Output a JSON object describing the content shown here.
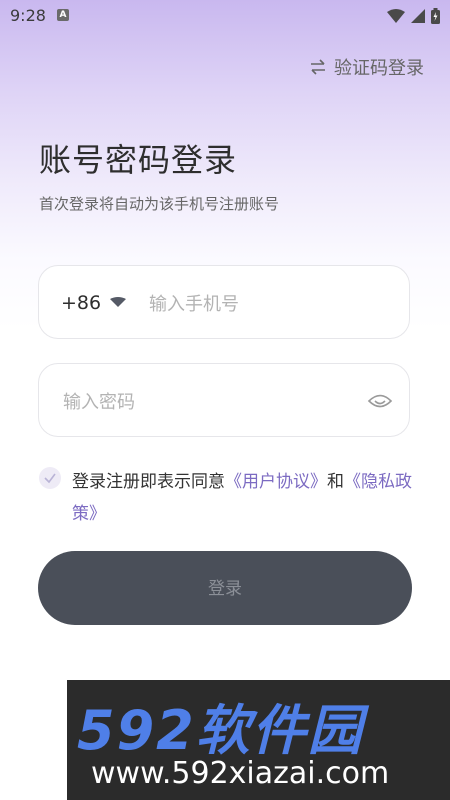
{
  "status_bar": {
    "time": "9:28",
    "badge": "A"
  },
  "header": {
    "switch_label": "验证码登录",
    "switch_icon": "swap-icon"
  },
  "title": "账号密码登录",
  "subtitle": "首次登录将自动为该手机号注册账号",
  "phone": {
    "country_code": "+86",
    "placeholder": "输入手机号"
  },
  "password": {
    "placeholder": "输入密码"
  },
  "agreement": {
    "prefix": "登录注册即表示同意",
    "user_agreement": "《用户协议》",
    "conjunction": "和",
    "privacy_policy": "《隐私政策》"
  },
  "login_button": "登录",
  "watermark": {
    "brand": "592软件园",
    "url": "www.592xiazai.com"
  },
  "colors": {
    "accent": "#7c6bc2",
    "button_bg": "#4a4f59",
    "watermark_blue": "#4f7fe8"
  }
}
